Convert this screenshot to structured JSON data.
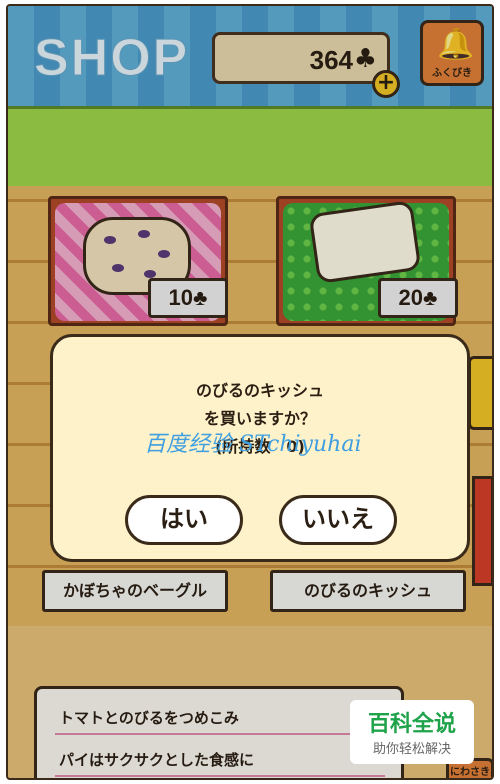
{
  "header": {
    "title": "SHOP",
    "coins": "364",
    "clover_symbol": "♣",
    "plus_label": "+",
    "lottery_label": "ふくびき",
    "lottery_icon": "hand-bell-icon"
  },
  "shelf": {
    "items": [
      {
        "name": "かぼちゃのベーグル",
        "price": "10",
        "currency": "♣"
      },
      {
        "name": "のびるのキッシュ",
        "price": "20",
        "currency": "♣"
      }
    ]
  },
  "dialog": {
    "line1": "のびるのキッシュ",
    "line2": "を買いますか？",
    "line3": "(所持数　0)",
    "yes_label": "はい",
    "no_label": "いいえ"
  },
  "description": {
    "line1": "トマトとのびるをつめこみ",
    "line2": "パイはサクサクとした食感に"
  },
  "watermark": "百度经验 STchiyuhai",
  "logo": {
    "title": "百科全说",
    "subtitle": "助你轻松解决"
  },
  "corner_button_label": "にわさき",
  "colors": {
    "header_blue": "#5fb0d8",
    "wall_green": "#9fd54a",
    "dialog_bg": "#fdf2c9",
    "wood": "#e4b761"
  }
}
